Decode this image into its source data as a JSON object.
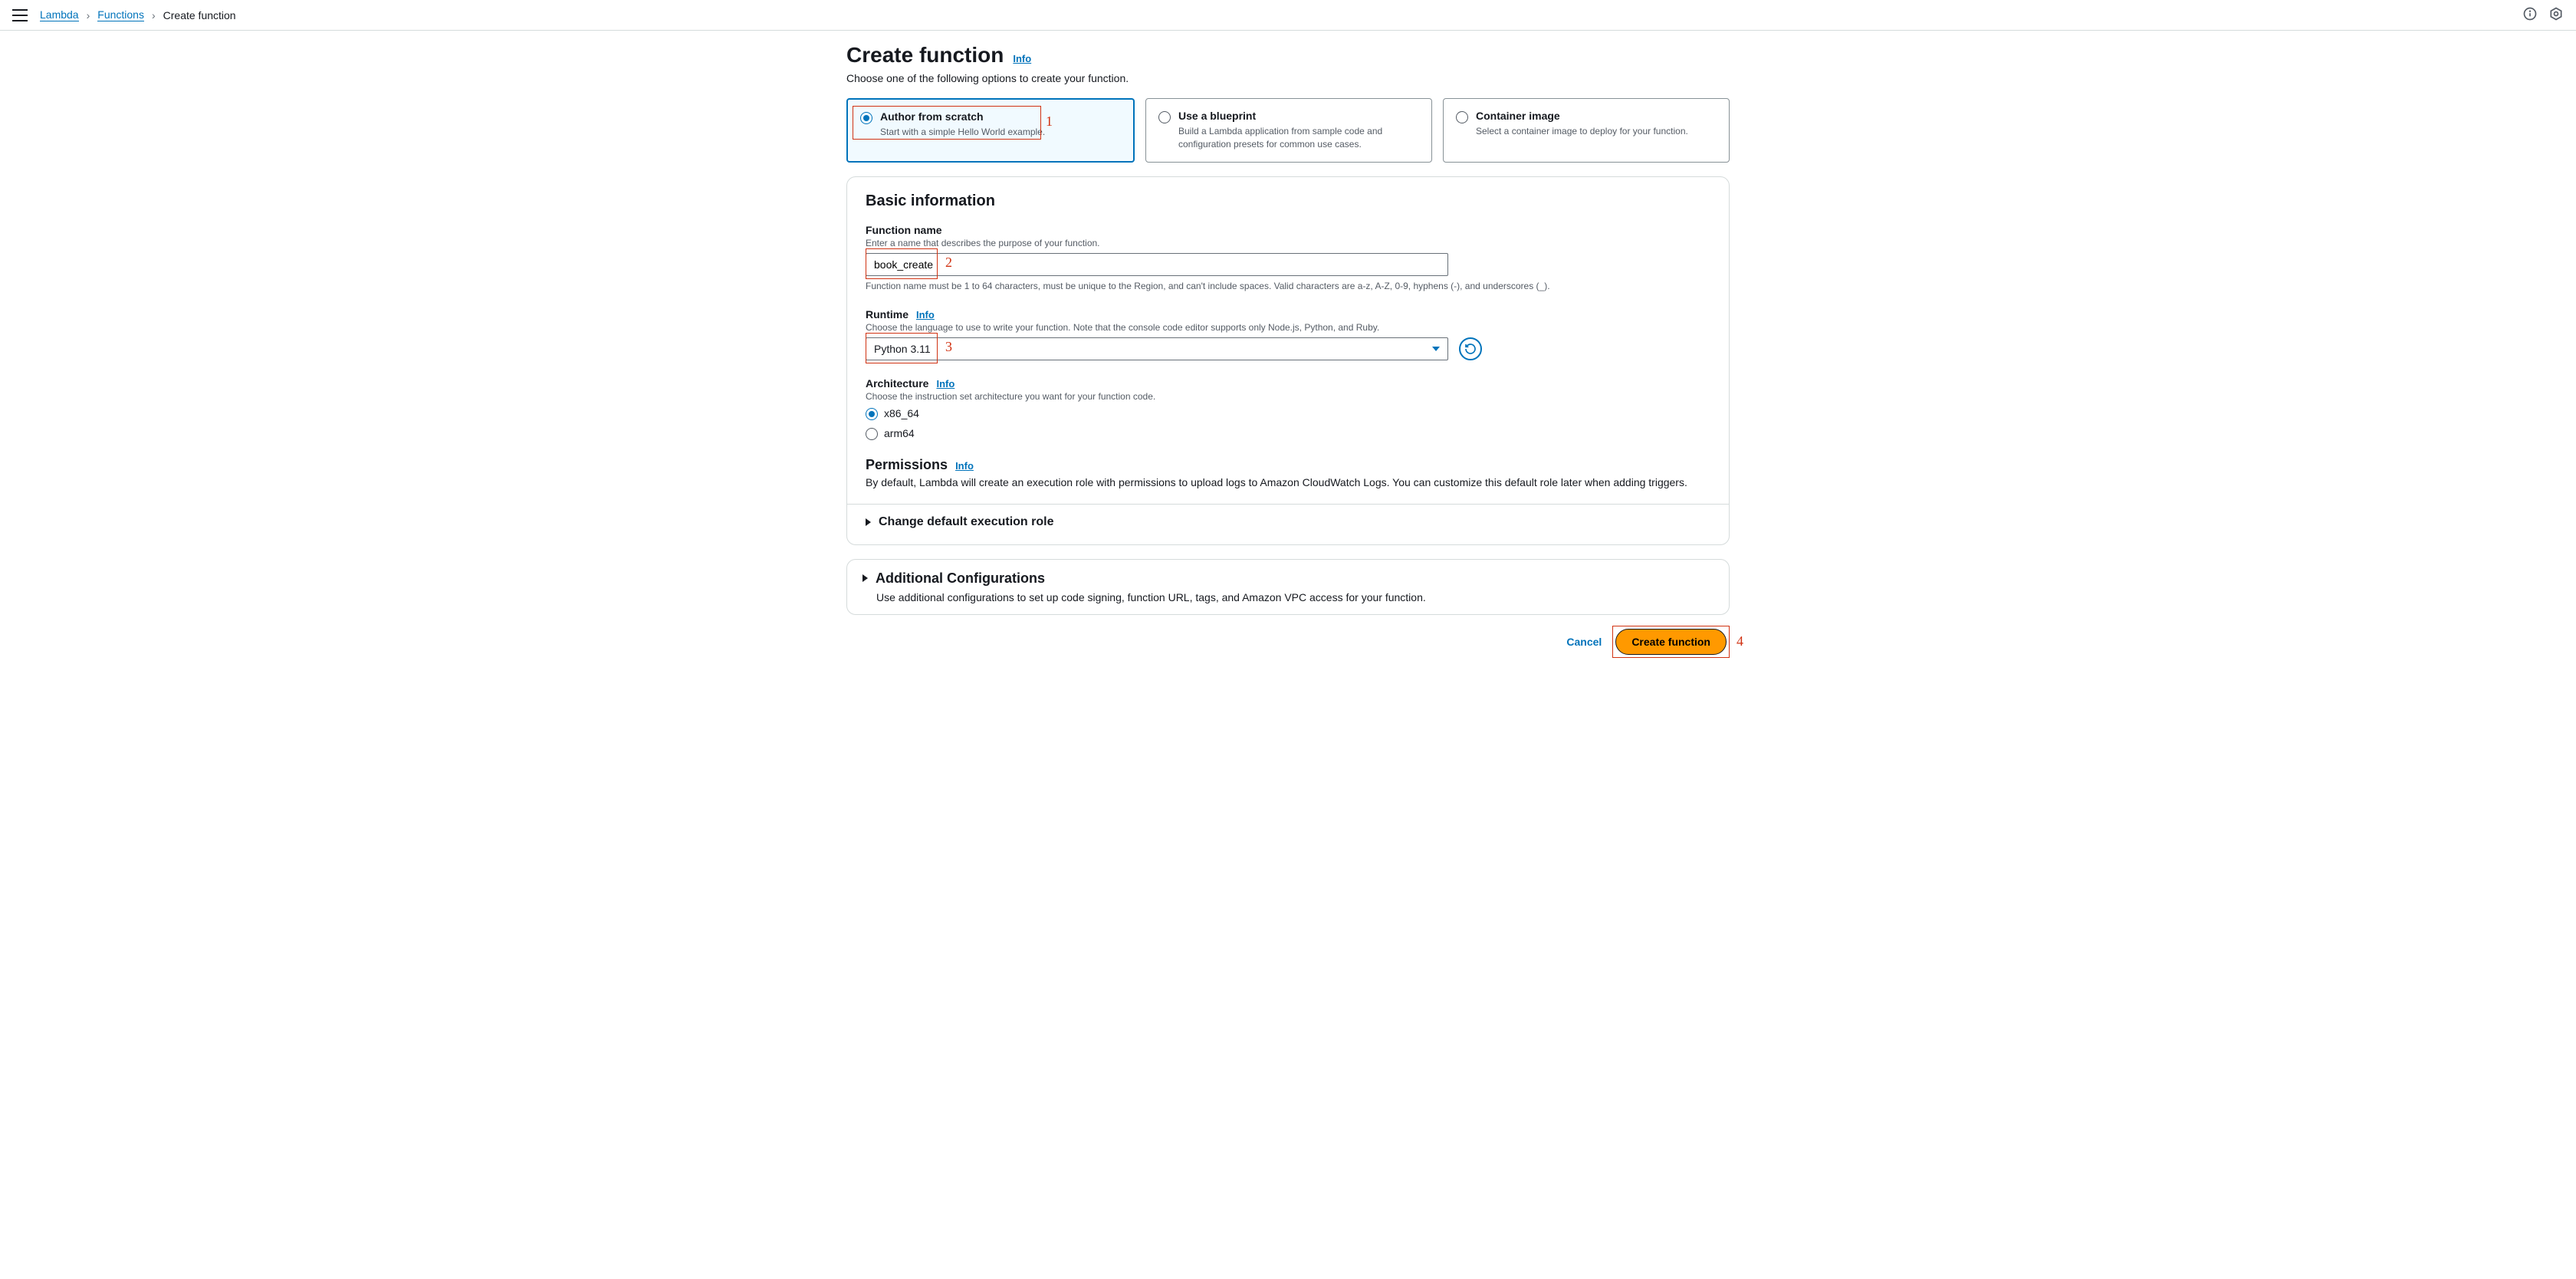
{
  "breadcrumb": {
    "root": "Lambda",
    "mid": "Functions",
    "current": "Create function"
  },
  "page": {
    "title": "Create function",
    "info": "Info",
    "subtitle": "Choose one of the following options to create your function."
  },
  "options": [
    {
      "title": "Author from scratch",
      "desc": "Start with a simple Hello World example."
    },
    {
      "title": "Use a blueprint",
      "desc": "Build a Lambda application from sample code and configuration presets for common use cases."
    },
    {
      "title": "Container image",
      "desc": "Select a container image to deploy for your function."
    }
  ],
  "basic": {
    "panel_title": "Basic information",
    "fn_label": "Function name",
    "fn_hint": "Enter a name that describes the purpose of your function.",
    "fn_value": "book_create",
    "fn_constraint": "Function name must be 1 to 64 characters, must be unique to the Region, and can't include spaces. Valid characters are a-z, A-Z, 0-9, hyphens (-), and underscores (_).",
    "runtime_label": "Runtime",
    "runtime_info": "Info",
    "runtime_hint": "Choose the language to use to write your function. Note that the console code editor supports only Node.js, Python, and Ruby.",
    "runtime_value": "Python 3.11",
    "arch_label": "Architecture",
    "arch_info": "Info",
    "arch_hint": "Choose the instruction set architecture you want for your function code.",
    "arch_options": [
      "x86_64",
      "arm64"
    ],
    "permissions_label": "Permissions",
    "permissions_info": "Info",
    "permissions_text": "By default, Lambda will create an execution role with permissions to upload logs to Amazon CloudWatch Logs. You can customize this default role later when adding triggers.",
    "exec_role_expander": "Change default execution role"
  },
  "additional": {
    "title": "Additional Configurations",
    "desc": "Use additional configurations to set up code signing, function URL, tags, and Amazon VPC access for your function."
  },
  "footer": {
    "cancel": "Cancel",
    "create": "Create function"
  },
  "annotations": {
    "a1": "1",
    "a2": "2",
    "a3": "3",
    "a4": "4"
  }
}
